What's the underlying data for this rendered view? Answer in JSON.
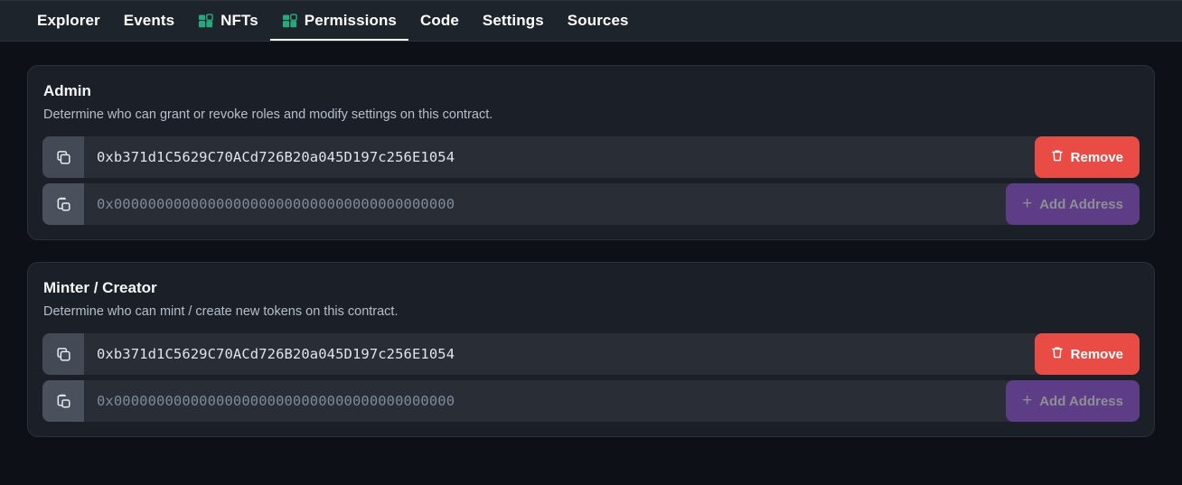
{
  "nav": {
    "items": [
      {
        "label": "Explorer",
        "icon": null,
        "active": false
      },
      {
        "label": "Events",
        "icon": null,
        "active": false
      },
      {
        "label": "NFTs",
        "icon": "blocks-icon",
        "active": false
      },
      {
        "label": "Permissions",
        "icon": "blocks-icon",
        "active": true
      },
      {
        "label": "Code",
        "icon": null,
        "active": false
      },
      {
        "label": "Settings",
        "icon": null,
        "active": false
      },
      {
        "label": "Sources",
        "icon": null,
        "active": false
      }
    ]
  },
  "colors": {
    "page_bg": "#0d1117",
    "nav_bg": "#1d242c",
    "card_bg": "#1b2028",
    "row_bg": "#282d36",
    "accent_green": "#2aa87d",
    "remove_red": "#e94b45",
    "add_purple": "#5c3d86",
    "active_underline": "#ffffff"
  },
  "cards": [
    {
      "title": "Admin",
      "description": "Determine who can grant or revoke roles and modify settings on this contract.",
      "rows": [
        {
          "icon": "copy-icon",
          "value": "0xb371d1C5629C70ACd726B20a045D197c256E1054",
          "is_placeholder": false,
          "button": {
            "label": "Remove",
            "icon": "trash-icon",
            "kind": "remove"
          }
        },
        {
          "icon": "paste-icon",
          "value": "0x0000000000000000000000000000000000000000",
          "is_placeholder": true,
          "button": {
            "label": "Add Address",
            "icon": "plus-icon",
            "kind": "add"
          }
        }
      ]
    },
    {
      "title": "Minter / Creator",
      "description": "Determine who can mint / create new tokens on this contract.",
      "rows": [
        {
          "icon": "copy-icon",
          "value": "0xb371d1C5629C70ACd726B20a045D197c256E1054",
          "is_placeholder": false,
          "button": {
            "label": "Remove",
            "icon": "trash-icon",
            "kind": "remove"
          }
        },
        {
          "icon": "paste-icon",
          "value": "0x0000000000000000000000000000000000000000",
          "is_placeholder": true,
          "button": {
            "label": "Add Address",
            "icon": "plus-icon",
            "kind": "add"
          }
        }
      ]
    }
  ]
}
